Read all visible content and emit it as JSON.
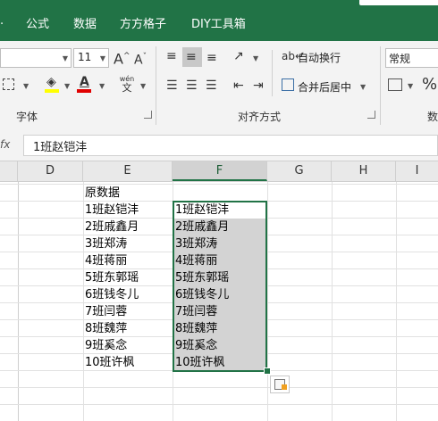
{
  "ribbon_tabs": [
    "公式",
    "数据",
    "方方格子",
    "DIY工具箱"
  ],
  "font": {
    "name_value": "",
    "size_value": "11",
    "grow_label": "A",
    "shrink_label": "A",
    "pinyin_top": "wén",
    "pinyin_bottom": "文",
    "group_label": "字体"
  },
  "alignment": {
    "wrap_label": "自动换行",
    "merge_label": "合并后居中",
    "group_label": "对齐方式"
  },
  "number": {
    "format_value": "常规",
    "percent_label": "%",
    "group_label": "数"
  },
  "formula_bar": {
    "fx_label": "fx",
    "content": "1班赵铠沣"
  },
  "columns": [
    "D",
    "E",
    "F",
    "G",
    "H",
    "I"
  ],
  "selected_column": "F",
  "column_e": [
    "原数据",
    "1班赵铠沣",
    "2班戚鑫月",
    "3班郑涛",
    "4班蒋丽",
    "5班东郭瑶",
    "6班钱冬儿",
    "7班闫蓉",
    "8班魏萍",
    "9班奚念",
    "10班许枫"
  ],
  "column_f": [
    "1班赵铠沣",
    "2班戚鑫月",
    "3班郑涛",
    "4班蒋丽",
    "5班东郭瑶",
    "6班钱冬儿",
    "7班闫蓉",
    "8班魏萍",
    "9班奚念",
    "10班许枫"
  ],
  "colors": {
    "accent": "#217346",
    "selection_fill": "#d3d3d3",
    "font_color_bar": "#e00000",
    "highlight_bar": "#ffff00"
  }
}
